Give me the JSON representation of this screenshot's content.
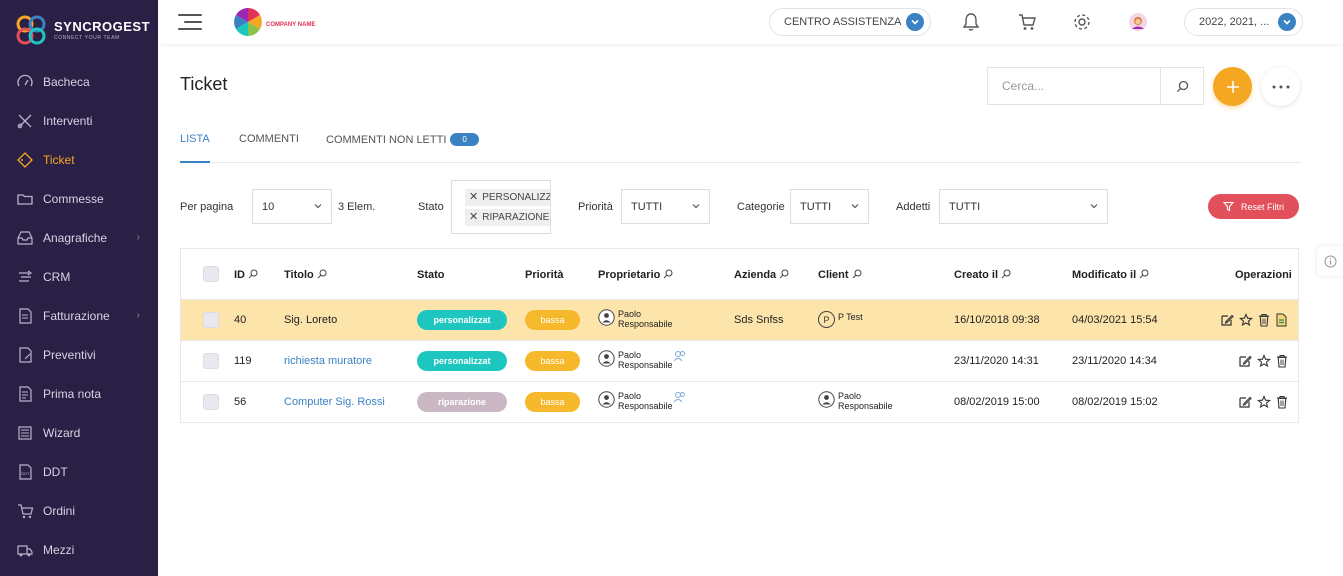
{
  "brand": {
    "name": "SYNCROGEST",
    "tagline": "CONNECT YOUR TEAM"
  },
  "sidebar": {
    "items": [
      {
        "label": "Bacheca",
        "icon": "dashboard-icon"
      },
      {
        "label": "Interventi",
        "icon": "tools-icon"
      },
      {
        "label": "Ticket",
        "icon": "ticket-icon",
        "active": true
      },
      {
        "label": "Commesse",
        "icon": "folder-icon"
      },
      {
        "label": "Anagrafiche",
        "icon": "inbox-icon",
        "has_children": true
      },
      {
        "label": "CRM",
        "icon": "crm-icon"
      },
      {
        "label": "Fatturazione",
        "icon": "invoice-icon",
        "has_children": true
      },
      {
        "label": "Preventivi",
        "icon": "quote-icon"
      },
      {
        "label": "Prima nota",
        "icon": "notes-icon"
      },
      {
        "label": "Wizard",
        "icon": "wizard-icon"
      },
      {
        "label": "DDT",
        "icon": "ddt-icon"
      },
      {
        "label": "Ordini",
        "icon": "cart-icon"
      },
      {
        "label": "Mezzi",
        "icon": "truck-icon"
      }
    ]
  },
  "header": {
    "company_name": "COMPANY NAME",
    "help_center": "CENTRO ASSISTENZA",
    "years": "2022, 2021, ..."
  },
  "page": {
    "title": "Ticket",
    "search_placeholder": "Cerca..."
  },
  "tabs": [
    {
      "label": "LISTA",
      "active": true
    },
    {
      "label": "COMMENTI"
    },
    {
      "label": "COMMENTI NON LETTI",
      "badge": "0"
    }
  ],
  "filters": {
    "per_page_label": "Per pagina",
    "per_page_value": "10",
    "count": "3 Elem.",
    "stato_label": "Stato",
    "stato_tags": [
      "PERSONALIZZAT",
      "RIPARAZIONE"
    ],
    "priorita_label": "Priorità",
    "priorita_value": "TUTTI",
    "categorie_label": "Categorie",
    "categorie_value": "TUTTI",
    "addetti_label": "Addetti",
    "addetti_value": "TUTTI",
    "reset_label": "Reset Filtri"
  },
  "table": {
    "columns": {
      "id": "ID",
      "titolo": "Titolo",
      "stato": "Stato",
      "priorita": "Priorità",
      "proprietario": "Proprietario",
      "azienda": "Azienda",
      "client": "Client",
      "creato": "Creato il",
      "modificato": "Modificato il",
      "operazioni": "Operazioni"
    },
    "rows": [
      {
        "id": "40",
        "titolo": "Sig. Loreto",
        "stato": "personalizzat",
        "stato_color": "#1dc7c0",
        "priorita": "bassa",
        "owner_first": "Paolo",
        "owner_last": "Responsabile",
        "azienda": "Sds Snfss",
        "client_badge": "P",
        "client": "P Test",
        "client_first": "",
        "client_last": "",
        "creato": "16/10/2018 09:38",
        "modificato": "04/03/2021 15:54",
        "highlight": true
      },
      {
        "id": "119",
        "titolo": "richiesta muratore",
        "stato": "personalizzat",
        "stato_color": "#1dc7c0",
        "priorita": "bassa",
        "owner_first": "Paolo",
        "owner_last": "Responsabile",
        "azienda": "",
        "client_badge": "",
        "client": "",
        "client_first": "",
        "client_last": "",
        "creato": "23/11/2020 14:31",
        "modificato": "23/11/2020 14:34",
        "highlight": false
      },
      {
        "id": "56",
        "titolo": "Computer Sig. Rossi",
        "stato": "riparazione",
        "stato_color": "#c9b8c4",
        "priorita": "bassa",
        "owner_first": "Paolo",
        "owner_last": "Responsabile",
        "azienda": "",
        "client_badge": "",
        "client": "",
        "client_first": "Paolo",
        "client_last": "Responsabile",
        "creato": "08/02/2019 15:00",
        "modificato": "08/02/2019 15:02",
        "highlight": false
      }
    ]
  },
  "colors": {
    "accent": "#f5a623",
    "primary": "#3b82c4",
    "sidebar": "#2a1f45",
    "danger": "#e2505c"
  }
}
